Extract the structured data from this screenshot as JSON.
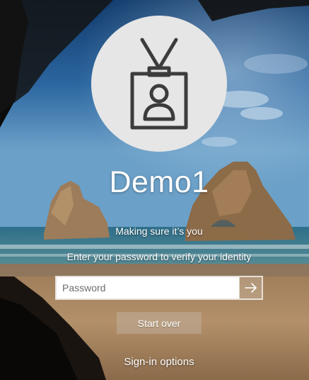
{
  "user": {
    "name": "Demo1",
    "avatar_icon": "id-badge-icon"
  },
  "verify": {
    "title": "Making sure it’s you",
    "instruction": "Enter your password to verify your identity"
  },
  "password": {
    "placeholder": "Password",
    "value": "",
    "submit_icon": "arrow-right-icon"
  },
  "buttons": {
    "start_over": "Start over",
    "sign_in_options": "Sign-in options"
  },
  "colors": {
    "avatar_bg": "#e6e6e6",
    "icon_stroke": "#3c3c3c",
    "text": "#ffffff"
  }
}
